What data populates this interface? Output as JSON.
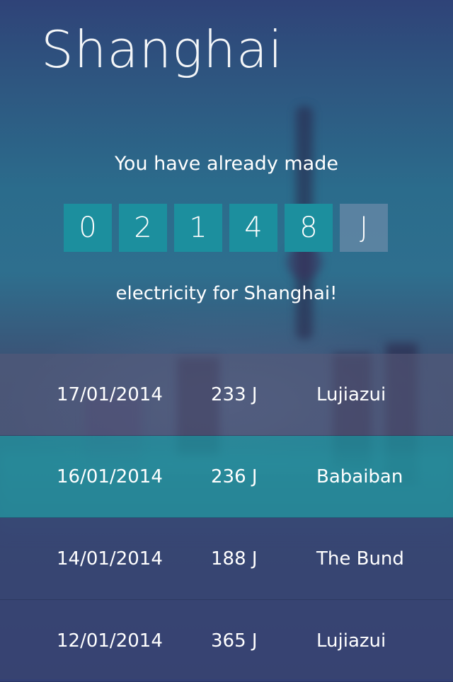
{
  "header": {
    "title": "Shanghai"
  },
  "summary": {
    "intro": "You have already made",
    "digits": [
      "0",
      "2",
      "1",
      "4",
      "8"
    ],
    "unit": "J",
    "outro": "electricity for Shanghai!"
  },
  "history": [
    {
      "date": "17/01/2014",
      "energy": "233 J",
      "place": "Lujiazui"
    },
    {
      "date": "16/01/2014",
      "energy": "236 J",
      "place": "Babaiban"
    },
    {
      "date": "14/01/2014",
      "energy": "188 J",
      "place": "The Bund"
    },
    {
      "date": "12/01/2014",
      "energy": "365 J",
      "place": "Lujiazui"
    }
  ],
  "colors": {
    "digit_bg": "#1c8f9e",
    "selected_row": "#2196a0"
  }
}
